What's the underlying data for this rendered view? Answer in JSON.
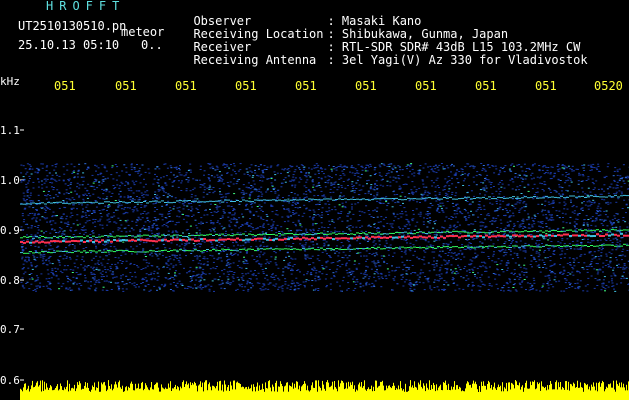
{
  "header": {
    "app_title": "HROFFT",
    "file_name": "UT2510130510.pn",
    "mode": "meteor",
    "date_time": "25.10.13 05:10",
    "extra_flag": "0..",
    "meta": [
      {
        "label": "Observer",
        "value": ": Masaki Kano"
      },
      {
        "label": "Receiving Location",
        "value": ": Shibukawa, Gunma, Japan"
      },
      {
        "label": "Receiver",
        "value": ": RTL-SDR SDR# 43dB L15 103.2MHz CW"
      },
      {
        "label": "Receiving Antenna",
        "value": ": 3el Yagi(V) Az 330 for Vladivostok"
      }
    ]
  },
  "axis": {
    "unit": "kHz",
    "y_ticks": [
      "1.1",
      "1.0",
      "0.9",
      "0.8",
      "0.7",
      "0.6"
    ],
    "time_labels": [
      "051",
      "051",
      "051",
      "051",
      "051",
      "051",
      "051",
      "051",
      "051",
      "0520"
    ]
  },
  "colors": {
    "background": "#000000",
    "header_cyan": "#5fe0e0",
    "time_yellow": "#ffff33",
    "signal_red": "#ff3050",
    "signal_green": "#30ff60",
    "noise_blue": "#1a3aa8",
    "amplitude_yellow": "#ffff00"
  }
}
